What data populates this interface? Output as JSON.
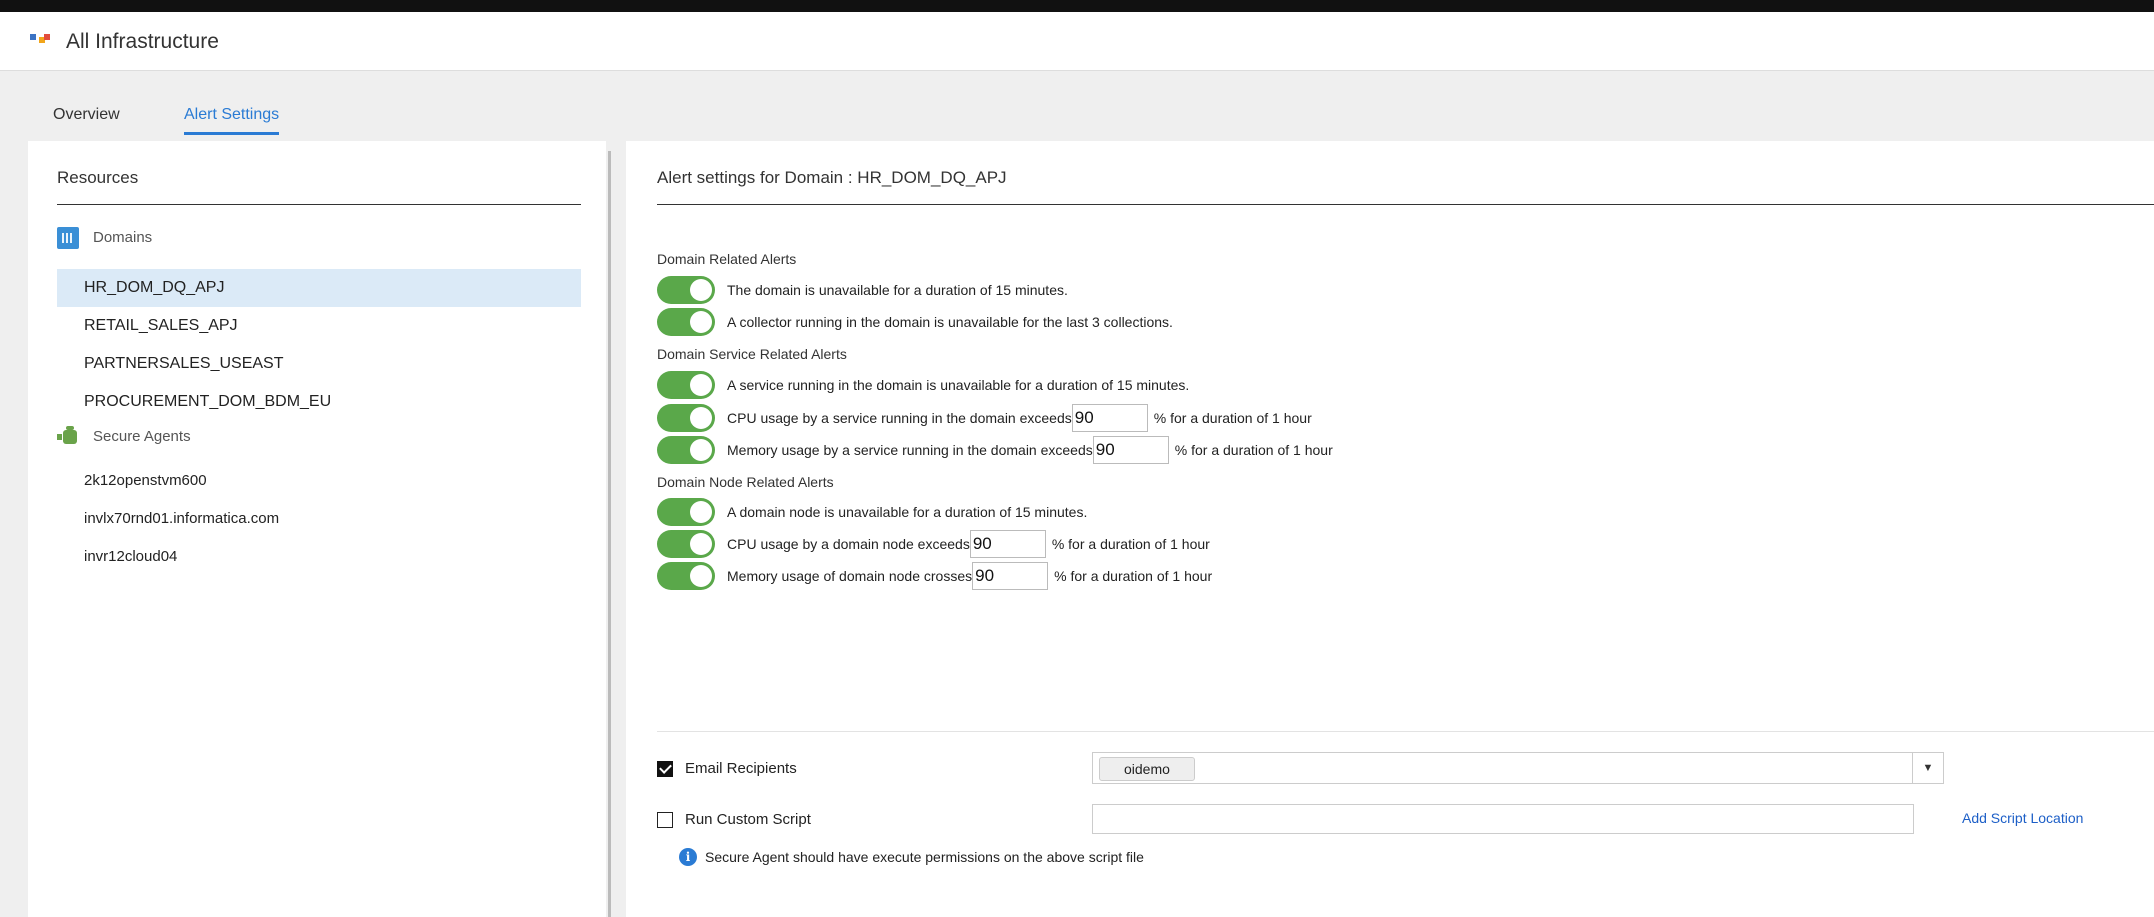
{
  "header": {
    "title": "All Infrastructure"
  },
  "tabs": [
    {
      "label": "Overview",
      "active": false
    },
    {
      "label": "Alert Settings",
      "active": true
    }
  ],
  "resources": {
    "title": "Resources",
    "domains_label": "Domains",
    "domains": [
      "HR_DOM_DQ_APJ",
      "RETAIL_SALES_APJ",
      "PARTNERSALES_USEAST",
      "PROCUREMENT_DOM_BDM_EU"
    ],
    "selected_domain": "HR_DOM_DQ_APJ",
    "agents_label": "Secure Agents",
    "agents": [
      "2k12openstvm600",
      "invlx70rnd01.informatica.com",
      "invr12cloud04"
    ]
  },
  "settings": {
    "title": "Alert settings for Domain : HR_DOM_DQ_APJ",
    "domain_section": "Domain Related Alerts",
    "domain_alerts": [
      "The domain is unavailable for a duration of 15 minutes.",
      "A collector running in the domain is unavailable for the last 3 collections."
    ],
    "service_section": "Domain Service Related Alerts",
    "service_alert_unavailable": "A service running in the domain is unavailable for a duration of 15 minutes.",
    "service_cpu_label": "CPU usage by a service running in the domain exceeds",
    "service_cpu_value": "90",
    "service_mem_label": "Memory usage by a service running in the domain exceeds",
    "service_mem_value": "90",
    "node_section": "Domain Node Related Alerts",
    "node_alert_unavailable": "A domain node is unavailable for a duration of 15 minutes.",
    "node_cpu_label": "CPU usage by a domain node exceeds",
    "node_cpu_value": "90",
    "node_mem_label": "Memory usage of domain node crosses",
    "node_mem_value": "90",
    "duration_suffix": "% for a duration of 1 hour",
    "email_label": "Email Recipients",
    "email_checked": true,
    "email_recipient": "oidemo",
    "script_label": "Run Custom Script",
    "script_checked": false,
    "script_value": "",
    "add_script_link": "Add Script Location",
    "info_text": "Secure Agent should have execute permissions on the above script file"
  },
  "colors": {
    "accent": "#2a7bd4",
    "toggle_on": "#5aa84a",
    "selected_bg": "#dbeaf7",
    "link": "#1d5fc7"
  },
  "icons": {
    "domains": "domain-grid-icon",
    "agents": "secure-agent-icon",
    "info": "info-icon",
    "dropdown": "caret-down-icon"
  }
}
